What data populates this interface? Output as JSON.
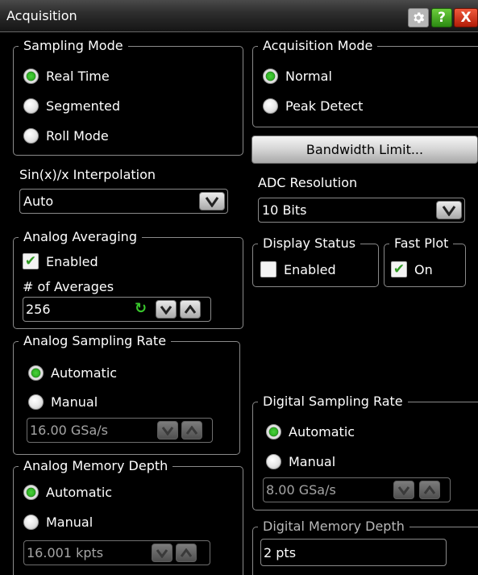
{
  "window": {
    "title": "Acquisition"
  },
  "sampling_mode": {
    "legend": "Sampling Mode",
    "options": [
      "Real Time",
      "Segmented",
      "Roll Mode"
    ],
    "selected": "Real Time"
  },
  "acquisition_mode": {
    "legend": "Acquisition Mode",
    "options": [
      "Normal",
      "Peak Detect"
    ],
    "selected": "Normal"
  },
  "bandwidth_limit": {
    "label": "Bandwidth Limit..."
  },
  "interpolation": {
    "label": "Sin(x)/x Interpolation",
    "value": "Auto"
  },
  "adc_resolution": {
    "label": "ADC Resolution",
    "value": "10 Bits"
  },
  "analog_averaging": {
    "legend": "Analog Averaging",
    "enabled_label": "Enabled",
    "enabled": true,
    "count_label": "# of Averages",
    "count": "256"
  },
  "display_status": {
    "legend": "Display Status",
    "enabled_label": "Enabled",
    "enabled": false
  },
  "fast_plot": {
    "legend": "Fast Plot",
    "on_label": "On",
    "on": true
  },
  "analog_sampling_rate": {
    "legend": "Analog Sampling Rate",
    "automatic_label": "Automatic",
    "manual_label": "Manual",
    "selected": "Automatic",
    "value": "16.00 GSa/s"
  },
  "digital_sampling_rate": {
    "legend": "Digital Sampling Rate",
    "automatic_label": "Automatic",
    "manual_label": "Manual",
    "selected": "Automatic",
    "value": "8.00 GSa/s"
  },
  "analog_memory_depth": {
    "legend": "Analog Memory Depth",
    "automatic_label": "Automatic",
    "manual_label": "Manual",
    "selected": "Automatic",
    "value": "16.001 kpts"
  },
  "digital_memory_depth": {
    "legend": "Digital Memory Depth",
    "value": "2 pts"
  },
  "icons": {
    "gear": "gear-icon",
    "help": "help-icon",
    "close": "close-icon",
    "dropdown": "chevron-down-icon",
    "spin_down": "chevron-down-icon",
    "spin_up": "chevron-up-icon",
    "refresh": "refresh-icon"
  },
  "colors": {
    "background": "#000000",
    "selected_radio": "#2fb325",
    "checkmark": "#2f9a22",
    "close_button": "#d03010",
    "help_button": "#3caa1c"
  },
  "glyphs": {
    "help": "?",
    "close": "X",
    "check": "✔",
    "refresh": "↻"
  }
}
